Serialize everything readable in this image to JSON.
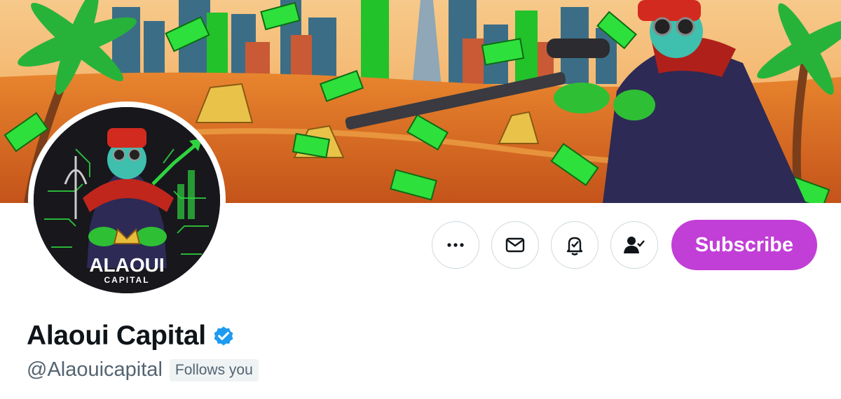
{
  "profile": {
    "display_name": "Alaoui Capital",
    "handle": "@Alaouicapital",
    "follows_you_label": "Follows you",
    "verified_badge_color": "#1d9bf0"
  },
  "avatar": {
    "logo_text": "ALAOUI",
    "logo_subtext": "CAPITAL"
  },
  "actions": {
    "more_icon": "more-horizontal-icon",
    "message_icon": "envelope-icon",
    "notify_icon": "bell-check-icon",
    "following_icon": "user-check-icon",
    "subscribe_label": "Subscribe",
    "subscribe_color": "#c13fd6"
  },
  "banner": {
    "description_icon": "desert-city-sniper-banner"
  }
}
